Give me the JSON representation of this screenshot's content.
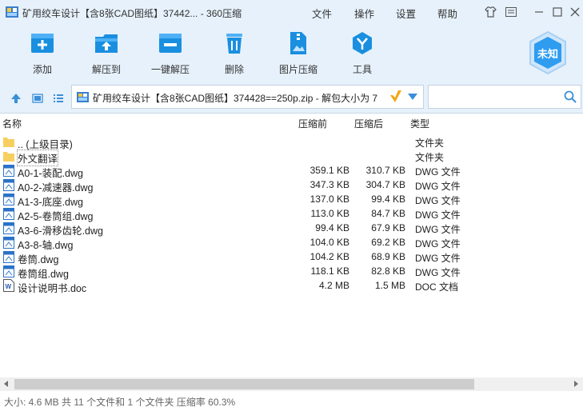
{
  "window": {
    "title": "矿用绞车设计【含8张CAD图纸】37442... - 360压缩",
    "menu": [
      "文件",
      "操作",
      "设置",
      "帮助"
    ]
  },
  "toolbar": {
    "add": "添加",
    "extract_to": "解压到",
    "one_click_extract": "一键解压",
    "delete": "删除",
    "image_compress": "图片压缩",
    "tools": "工具",
    "badge": "未知"
  },
  "address": {
    "path": "矿用绞车设计【含8张CAD图纸】374428==250p.zip - 解包大小为 7",
    "search_placeholder": ""
  },
  "columns": {
    "name": "名称",
    "compressed_before": "压缩前",
    "compressed_after": "压缩后",
    "type": "类型"
  },
  "files": [
    {
      "name": ".. (上级目录)",
      "before": "",
      "after": "",
      "type": "文件夹",
      "icon": "folder-icon"
    },
    {
      "name": "外文翻译",
      "before": "",
      "after": "",
      "type": "文件夹",
      "icon": "folder-icon"
    },
    {
      "name": "A0-1-装配.dwg",
      "before": "359.1 KB",
      "after": "310.7 KB",
      "type": "DWG 文件",
      "icon": "dwg-file-icon"
    },
    {
      "name": "A0-2-减速器.dwg",
      "before": "347.3 KB",
      "after": "304.7 KB",
      "type": "DWG 文件",
      "icon": "dwg-file-icon"
    },
    {
      "name": "A1-3-底座.dwg",
      "before": "137.0 KB",
      "after": "99.4 KB",
      "type": "DWG 文件",
      "icon": "dwg-file-icon"
    },
    {
      "name": "A2-5-卷筒组.dwg",
      "before": "113.0 KB",
      "after": "84.7 KB",
      "type": "DWG 文件",
      "icon": "dwg-file-icon"
    },
    {
      "name": "A3-6-滑移齿轮.dwg",
      "before": "99.4 KB",
      "after": "67.9 KB",
      "type": "DWG 文件",
      "icon": "dwg-file-icon"
    },
    {
      "name": "A3-8-轴.dwg",
      "before": "104.0 KB",
      "after": "69.2 KB",
      "type": "DWG 文件",
      "icon": "dwg-file-icon"
    },
    {
      "name": "卷筒.dwg",
      "before": "104.2 KB",
      "after": "68.9 KB",
      "type": "DWG 文件",
      "icon": "dwg-file-icon"
    },
    {
      "name": "卷筒组.dwg",
      "before": "118.1 KB",
      "after": "82.8 KB",
      "type": "DWG 文件",
      "icon": "dwg-file-icon"
    },
    {
      "name": "设计说明书.doc",
      "before": "4.2 MB",
      "after": "1.5 MB",
      "type": "DOC 文档",
      "icon": "doc-file-icon"
    }
  ],
  "status": "大小: 4.6 MB 共 11 个文件和 1 个文件夹 压缩率 60.3%",
  "colors": {
    "accent": "#1a8fe0",
    "toolbar_bg": "#e6f1fb",
    "folder": "#f6cf5e"
  }
}
